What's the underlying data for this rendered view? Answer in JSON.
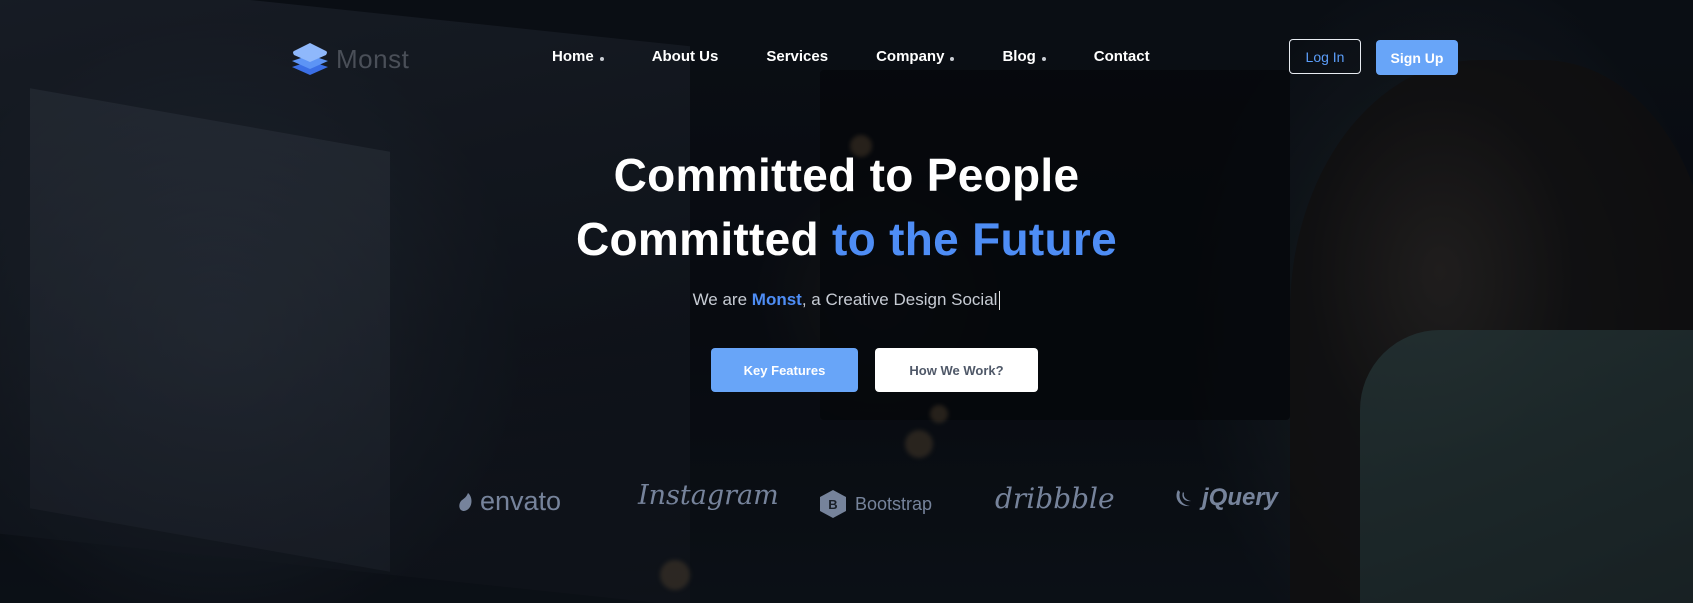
{
  "logo": {
    "text": "Monst",
    "icon": "layers-icon",
    "icon_colors": [
      "#3b6fe6",
      "#5d94f5",
      "#8fb8fb"
    ]
  },
  "nav": {
    "items": [
      {
        "label": "Home",
        "has_dropdown": true
      },
      {
        "label": "About Us",
        "has_dropdown": false
      },
      {
        "label": "Services",
        "has_dropdown": false
      },
      {
        "label": "Company",
        "has_dropdown": true
      },
      {
        "label": "Blog",
        "has_dropdown": true
      },
      {
        "label": "Contact",
        "has_dropdown": false
      }
    ],
    "login_label": "Log In",
    "signup_label": "Sign Up"
  },
  "hero": {
    "title_line1": "Committed to People",
    "title_line2_white": "Committed ",
    "title_line2_accent": "to the Future",
    "subtitle_prefix": "We are ",
    "subtitle_brand": "Monst",
    "subtitle_suffix": ", a Creative Design Social",
    "primary_button": "Key Features",
    "secondary_button": "How We Work?"
  },
  "brands": [
    {
      "name": "envato",
      "icon": "envato-leaf-icon"
    },
    {
      "name": "Instagram",
      "icon": ""
    },
    {
      "name": "Bootstrap",
      "icon": "bootstrap-b-icon"
    },
    {
      "name": "dribbble",
      "icon": ""
    },
    {
      "name": "jQuery",
      "icon": "jquery-swirl-icon"
    }
  ],
  "colors": {
    "accent": "#4e8df5",
    "button_blue": "#68a5f8"
  }
}
